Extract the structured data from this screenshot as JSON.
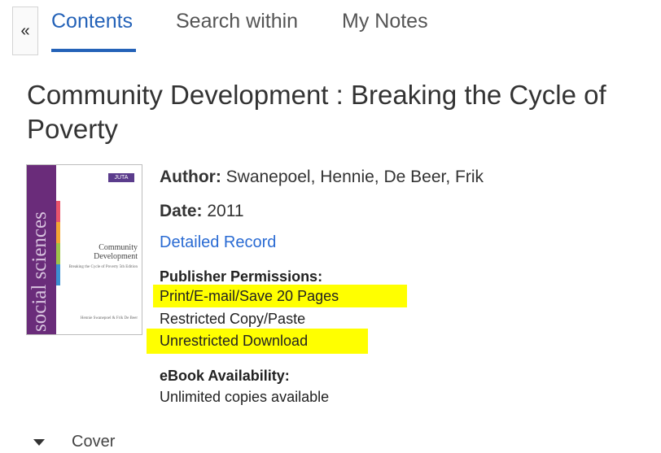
{
  "tabs": {
    "collapse_glyph": "«",
    "items": [
      {
        "label": "Contents",
        "active": true
      },
      {
        "label": "Search within",
        "active": false
      },
      {
        "label": "My Notes",
        "active": false
      }
    ]
  },
  "book": {
    "title": "Community Development : Breaking the Cycle of Poverty",
    "author_label": "Author:",
    "author": "Swanepoel, Hennie, De Beer, Frik",
    "date_label": "Date:",
    "date": "2011",
    "detail_link": "Detailed Record"
  },
  "cover": {
    "spine_text": "social sciences",
    "logo_text": "JUTA",
    "title": "Community Development",
    "subtitle": "Breaking the Cycle of Poverty 5th Edition",
    "authors": "Hennie Swanepoel & Frik De Beer",
    "colors": {
      "band": "#6a2c7a",
      "stripes": [
        "#e9546b",
        "#f3a533",
        "#9ec34a",
        "#3c8fd1"
      ]
    }
  },
  "permissions": {
    "heading": "Publisher Permissions:",
    "items": [
      {
        "text": "Print/E-mail/Save 20 Pages",
        "highlighted": true
      },
      {
        "text": "Restricted Copy/Paste",
        "highlighted": false
      },
      {
        "text": "Unrestricted Download",
        "highlighted": true
      }
    ],
    "highlight_color": "#ffff00"
  },
  "availability": {
    "heading": "eBook Availability:",
    "text": "Unlimited copies available"
  },
  "toc": {
    "expand_icon": "caret-down-icon",
    "first_item": "Cover"
  },
  "colors": {
    "accent": "#2462b8",
    "link": "#2a6bd3",
    "text": "#333333"
  }
}
